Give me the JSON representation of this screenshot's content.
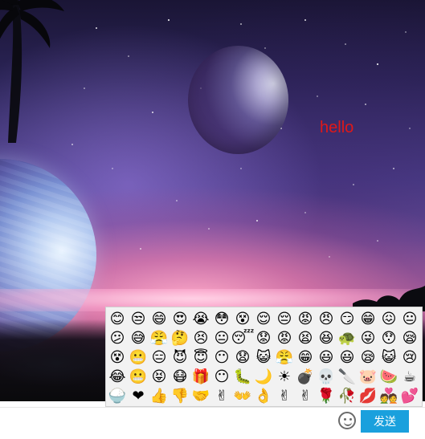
{
  "chat": {
    "message_text": "hello",
    "message_color": "#e01818"
  },
  "emoji_panel": {
    "emojis": [
      "😊",
      "😒",
      "😄",
      "😍",
      "😭",
      "😳",
      "😵",
      "😌",
      "😔",
      "😡",
      "😠",
      "😏",
      "😁",
      "😖",
      "😐",
      "😕",
      "😅",
      "😤",
      "🤔",
      "😣",
      "😐",
      "😴",
      "😟",
      "😡",
      "😫",
      "😆",
      "🐢",
      "😜",
      "😯",
      "😪",
      "😵",
      "😬",
      "😑",
      "😈",
      "😇",
      "😶",
      "😧",
      "😺",
      "😤",
      "😁",
      "😃",
      "😃",
      "😪",
      "😺",
      "😢",
      "😂",
      "😬",
      "😝",
      "😷",
      "🎁",
      "😶",
      "🐛",
      "🌙",
      "☀",
      "💣",
      "💀",
      "🔪",
      "🐷",
      "🍉",
      "☕",
      "🍚",
      "❤",
      "👍",
      "👎",
      "🤝",
      "✌",
      "👐",
      "👌",
      "✌",
      "✌",
      "🌹",
      "🥀",
      "💋",
      "💑",
      "💕"
    ]
  },
  "input": {
    "message_placeholder": "",
    "message_value": "",
    "emoji_icon_name": "smile-icon"
  },
  "buttons": {
    "send_label": "发送",
    "send_color": "#1aa0dd"
  }
}
